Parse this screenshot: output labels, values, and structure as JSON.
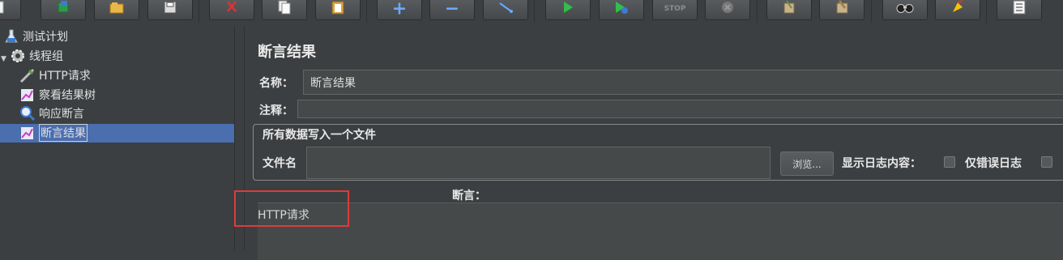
{
  "toolbar": {
    "buttons": [
      {
        "icon": "new-icon"
      },
      {
        "icon": "templates-icon"
      },
      {
        "icon": "open-icon"
      },
      {
        "icon": "save-icon"
      },
      {
        "icon": "cut-icon"
      },
      {
        "icon": "copy-icon"
      },
      {
        "icon": "paste-icon"
      },
      {
        "icon": "expand-icon",
        "glyph": "+"
      },
      {
        "icon": "collapse-icon",
        "glyph": "−"
      },
      {
        "icon": "toggle-icon"
      },
      {
        "icon": "start-icon"
      },
      {
        "icon": "start-no-pause-icon"
      },
      {
        "icon": "stop-icon",
        "glyph": "STOP"
      },
      {
        "icon": "shutdown-icon"
      },
      {
        "icon": "clear-icon"
      },
      {
        "icon": "clear-all-icon"
      },
      {
        "icon": "search-icon"
      },
      {
        "icon": "reset-search-icon"
      },
      {
        "icon": "function-helper-icon"
      }
    ]
  },
  "tree": {
    "items": [
      {
        "label": "测试计划",
        "icon": "test-plan-icon"
      },
      {
        "label": "线程组",
        "icon": "thread-group-icon"
      },
      {
        "label": "HTTP请求",
        "icon": "http-sampler-icon"
      },
      {
        "label": "察看结果树",
        "icon": "listener-icon"
      },
      {
        "label": "响应断言",
        "icon": "assertion-icon"
      },
      {
        "label": "断言结果",
        "icon": "listener-icon"
      }
    ],
    "selected": "断言结果"
  },
  "panel": {
    "title": "断言结果",
    "name_label": "名称：",
    "name_value": "断言结果",
    "comment_label": "注释：",
    "comment_value": "",
    "file_group_legend": "所有数据写入一个文件",
    "filename_label": "文件名",
    "filename_value": "",
    "browse_label": "浏览...",
    "log_display_label": "显示日志内容：",
    "errors_only_label": "仅错误日志",
    "assertions_header": "断言：",
    "results": [
      "HTTP请求"
    ]
  },
  "colors": {
    "background": "#3c3f41",
    "selection": "#4b6eaf",
    "highlight_box": "#e03a3a"
  }
}
